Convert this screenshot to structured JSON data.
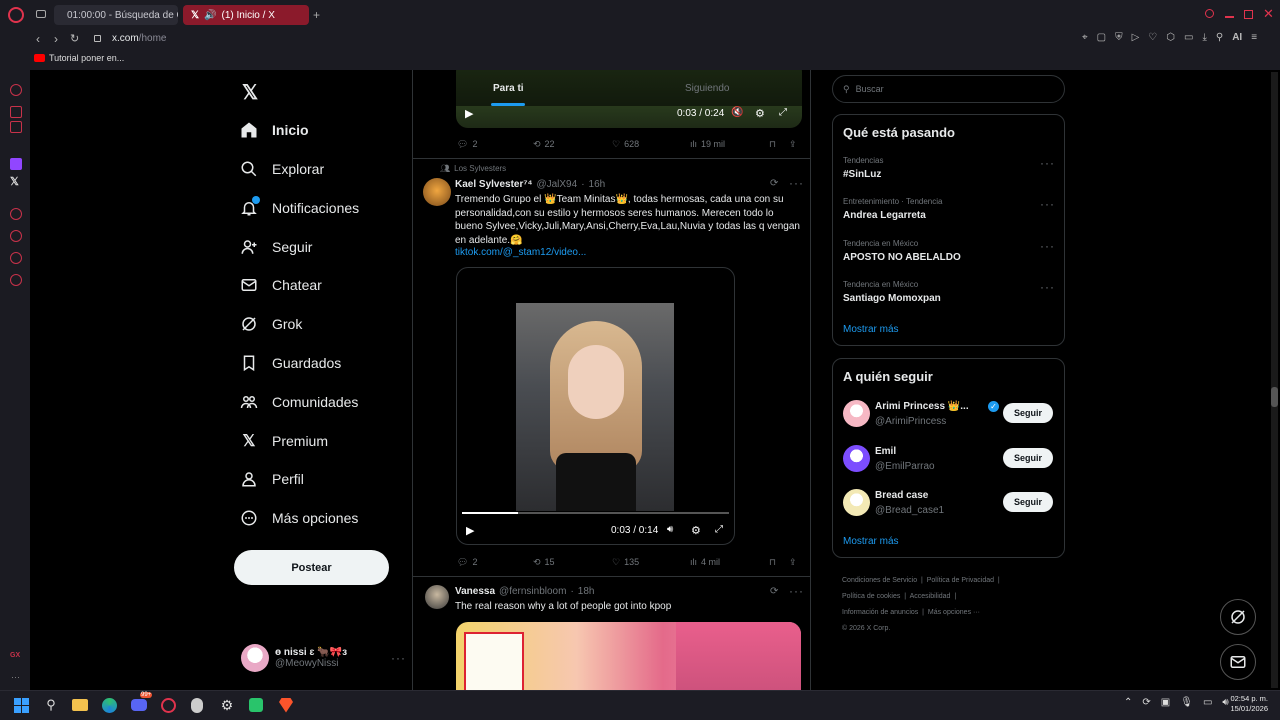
{
  "browser": {
    "tabs": [
      {
        "title": "01:00:00 - Búsqueda de G"
      },
      {
        "title": "(1) Inicio / X"
      }
    ],
    "url_host": "x.com",
    "url_path": "/home",
    "bookmark": "Tutorial poner en..."
  },
  "nav": {
    "items": [
      {
        "label": "Inicio",
        "icon": "home-icon"
      },
      {
        "label": "Explorar",
        "icon": "search-icon"
      },
      {
        "label": "Notificaciones",
        "icon": "bell-icon"
      },
      {
        "label": "Seguir",
        "icon": "follow-icon"
      },
      {
        "label": "Chatear",
        "icon": "mail-icon"
      },
      {
        "label": "Grok",
        "icon": "grok-icon"
      },
      {
        "label": "Guardados",
        "icon": "bookmark-icon"
      },
      {
        "label": "Comunidades",
        "icon": "communities-icon"
      },
      {
        "label": "Premium",
        "icon": "x-icon"
      },
      {
        "label": "Perfil",
        "icon": "person-icon"
      },
      {
        "label": "Más opciones",
        "icon": "more-circle-icon"
      }
    ],
    "post_button": "Postear",
    "account": {
      "name": "ɵ nissi ɛ 🐂🎀ɜ",
      "handle": "@MeowyNissi"
    }
  },
  "feed": {
    "tabs": [
      "Para ti",
      "Siguiendo"
    ],
    "top_video": {
      "time": "0:03 / 0:24",
      "progress": 0.125
    },
    "top_actions": {
      "replies": "2",
      "reposts": "22",
      "likes": "628",
      "views": "19 mil"
    },
    "tweet1": {
      "social_context": "Los Sylvesters",
      "name": "Kael Sylvester⁷⁴",
      "handle": "@JalX94",
      "time": "16h",
      "text": "Tremendo Grupo el 👑Team Minitas👑, todas hermosas, cada una con su personalidad,con su estilo y hermosos seres humanos. Merecen todo lo bueno Sylvee,Vicky,Juli,Mary,Ansi,Cherry,Eva,Lau,Nuvia y todas las q vengan en adelante.🤗",
      "link": "tiktok.com/@_stam12/video...",
      "video_time": "0:03 / 0:14",
      "video_progress": 0.21,
      "replies": "2",
      "reposts": "15",
      "likes": "135",
      "views": "4 mil"
    },
    "tweet2": {
      "name": "Vanessa",
      "handle": "@fernsinbloom",
      "time": "18h",
      "text": "The real reason why a lot of people got into kpop"
    }
  },
  "right": {
    "search_placeholder": "Buscar",
    "trends_title": "Qué está pasando",
    "trends": [
      {
        "meta": "Tendencias",
        "name": "#SinLuz"
      },
      {
        "meta": "Entretenimiento · Tendencia",
        "name": "Andrea Legarreta"
      },
      {
        "meta": "Tendencia en México",
        "name": "APOSTO NO ABELALDO"
      },
      {
        "meta": "Tendencia en México",
        "name": "Santiago Momoxpan"
      }
    ],
    "show_more": "Mostrar más",
    "follow_title": "A quién seguir",
    "follow": [
      {
        "name": "Arimi Princess 👑...",
        "handle": "@ArimiPrincess",
        "button": "Seguir",
        "color": "#f6b8c4"
      },
      {
        "name": "Emil",
        "handle": "@EmilParrao",
        "button": "Seguir",
        "color": "#7c4dff"
      },
      {
        "name": "Bread case",
        "handle": "@Bread_case1",
        "button": "Seguir",
        "color": "#f3e9b5"
      }
    ],
    "footer": [
      "Condiciones de Servicio",
      "Política de Privacidad",
      "Política de cookies",
      "Accesibilidad",
      "Información de anuncios",
      "Más opciones ···",
      "© 2026 X Corp."
    ]
  },
  "taskbar": {
    "time": "02:54 p. m.",
    "date": "15/01/2026",
    "discord_badge": "99+"
  },
  "colors": {
    "accent": "#1d9bf0",
    "opera_red": "#c8324a",
    "active_tab": "#8b1a2b"
  }
}
